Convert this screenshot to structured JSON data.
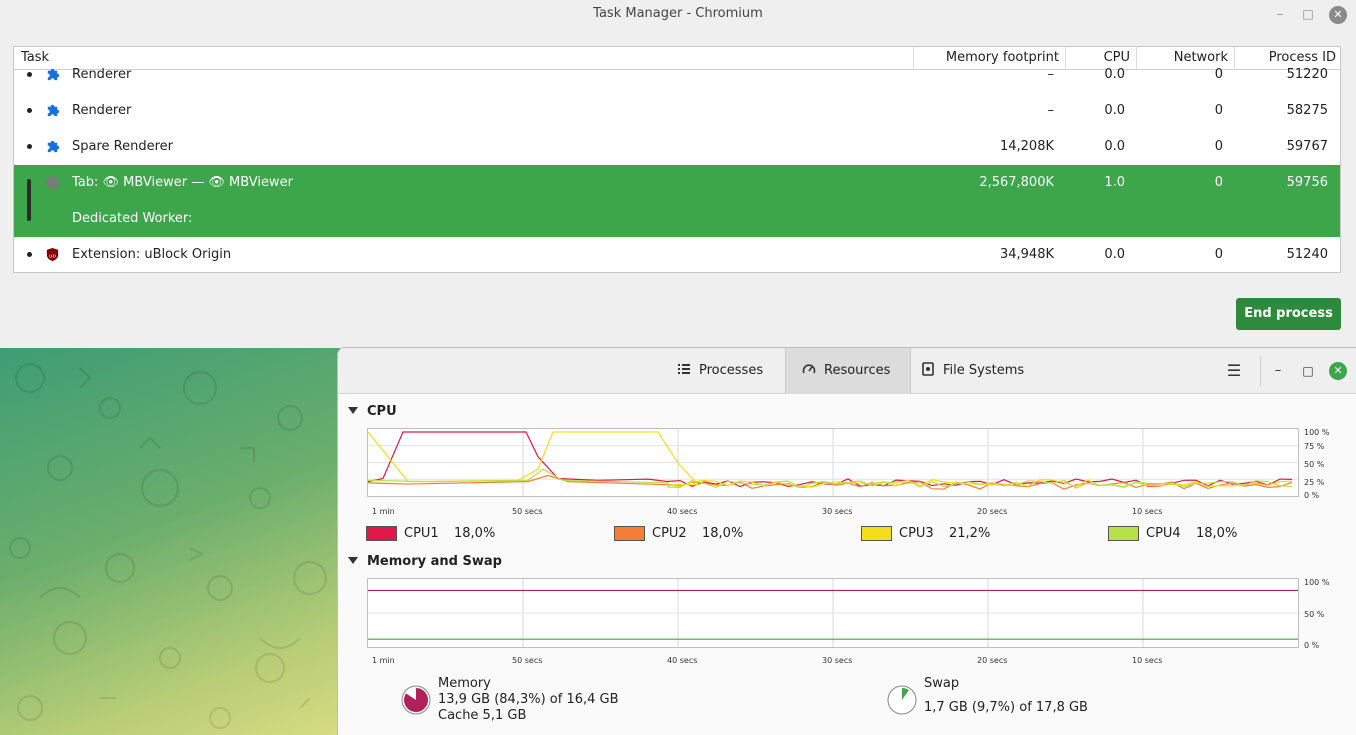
{
  "taskmanager": {
    "title": "Task Manager - Chromium",
    "columns": {
      "task": "Task",
      "memory": "Memory footprint",
      "cpu": "CPU",
      "network": "Network",
      "pid": "Process ID"
    },
    "rows": [
      {
        "name": "Renderer",
        "memory": "–",
        "cpu": "0.0",
        "network": "0",
        "pid": "51220",
        "icon": "puzzle-icon"
      },
      {
        "name": "Renderer",
        "memory": "–",
        "cpu": "0.0",
        "network": "0",
        "pid": "58275",
        "icon": "puzzle-icon"
      },
      {
        "name": "Spare Renderer",
        "memory": "14,208K",
        "cpu": "0.0",
        "network": "0",
        "pid": "59767",
        "icon": "puzzle-icon"
      },
      {
        "name": "Tab: 👁 MBViewer — 👁 MBViewer",
        "sub": "Dedicated Worker:",
        "memory": "2,567,800K",
        "cpu": "1.0",
        "network": "0",
        "pid": "59756",
        "icon": "globe-icon",
        "selected": true
      },
      {
        "name": "Extension: uBlock Origin",
        "memory": "34,948K",
        "cpu": "0.0",
        "network": "0",
        "pid": "51240",
        "icon": "ublock-icon"
      }
    ],
    "end_process": "End process"
  },
  "sysmon": {
    "tabs": {
      "processes": "Processes",
      "resources": "Resources",
      "filesystems": "File Systems"
    },
    "cpu_title": "CPU",
    "mem_title": "Memory and Swap",
    "x_labels": [
      "1 min",
      "50 secs",
      "40 secs",
      "30 secs",
      "20 secs",
      "10 secs"
    ],
    "cpu_y_labels": [
      "100 %",
      "75 %",
      "50 %",
      "25 %",
      "0 %"
    ],
    "mem_y_labels": [
      "100 %",
      "50 %",
      "0 %"
    ],
    "cpu_legend": [
      {
        "label": "CPU1",
        "value": "18,0%",
        "color": "#e0194a"
      },
      {
        "label": "CPU2",
        "value": "18,0%",
        "color": "#f57e36"
      },
      {
        "label": "CPU3",
        "value": "21,2%",
        "color": "#f5dd1a"
      },
      {
        "label": "CPU4",
        "value": "18,0%",
        "color": "#b7e049"
      }
    ],
    "memory": {
      "label": "Memory",
      "value": "13,9 GB (84,3%) of 16,4 GB",
      "cache": "Cache 5,1 GB",
      "color": "#b0205a",
      "percent": 84.3
    },
    "swap": {
      "label": "Swap",
      "value": "1,7 GB (9,7%) of 17,8 GB",
      "color": "#3da64a",
      "percent": 9.7
    }
  }
}
